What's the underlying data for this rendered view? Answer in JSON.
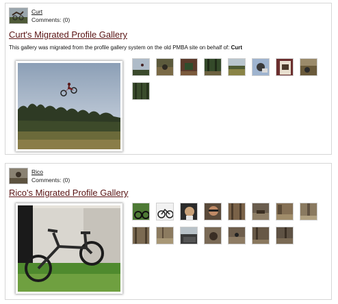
{
  "galleries": [
    {
      "owner": "Curt",
      "comments": "Comments: (0)",
      "title": "Curt's Migrated Profile Gallery",
      "description_prefix": "This gallery was migrated from the profile gallery system on the old PMBA site on behalf of: ",
      "description_name": "Curt",
      "thumbnails": [
        "thumb-1",
        "thumb-2",
        "thumb-3",
        "thumb-4",
        "thumb-5",
        "thumb-6",
        "thumb-7",
        "thumb-8",
        "thumb-9"
      ]
    },
    {
      "owner": "Rico",
      "comments": "Comments: (0)",
      "title": "Rico's Migrated Profile Gallery",
      "thumbnails": [
        "thumb-1",
        "thumb-2",
        "thumb-3",
        "thumb-4",
        "thumb-5",
        "thumb-6",
        "thumb-7",
        "thumb-8",
        "thumb-9",
        "thumb-10",
        "thumb-11",
        "thumb-12",
        "thumb-13",
        "thumb-14",
        "thumb-15"
      ]
    }
  ],
  "colors": {
    "title_link": "#5a1414",
    "card_border": "#d6d6d6"
  }
}
